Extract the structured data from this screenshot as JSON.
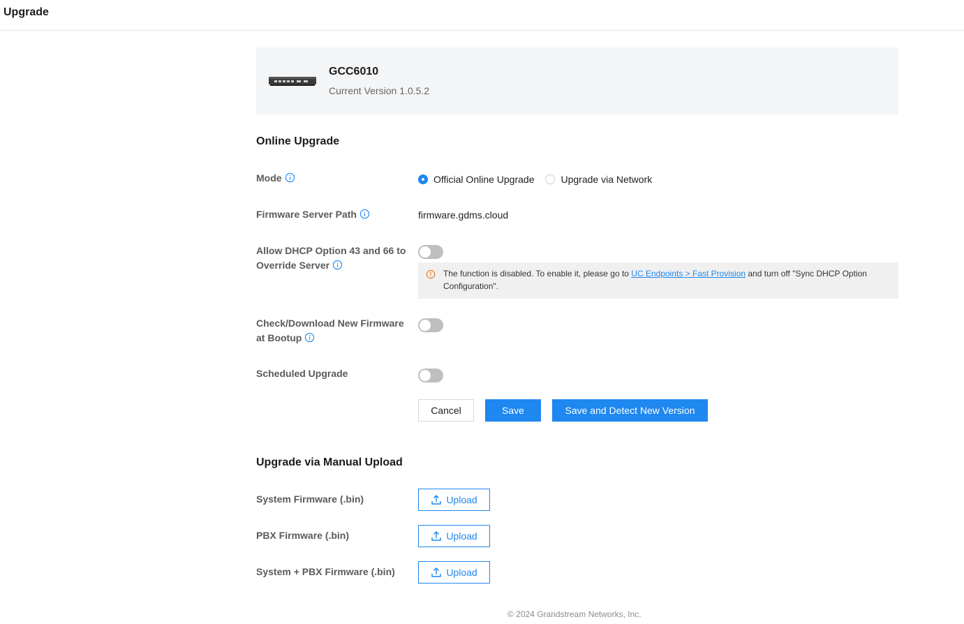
{
  "page": {
    "title": "Upgrade"
  },
  "device": {
    "image_icon": "network-device-icon",
    "name": "GCC6010",
    "version_label": "Current Version",
    "version": "1.0.5.2"
  },
  "online_upgrade": {
    "title": "Online Upgrade",
    "mode": {
      "label": "Mode",
      "options": [
        {
          "label": "Official Online Upgrade",
          "selected": true
        },
        {
          "label": "Upgrade via Network",
          "selected": false
        }
      ]
    },
    "firmware_server_path": {
      "label": "Firmware Server Path",
      "value": "firmware.gdms.cloud"
    },
    "dhcp_override": {
      "label": "Allow DHCP Option 43 and 66 to Override Server",
      "enabled": false,
      "notice_prefix": "The function is disabled. To enable it, please go to ",
      "notice_link": "UC Endpoints > Fast Provision",
      "notice_suffix": " and turn off \"Sync DHCP Option Configuration\"."
    },
    "check_at_bootup": {
      "label": "Check/Download New Firmware at Bootup",
      "enabled": false
    },
    "scheduled_upgrade": {
      "label": "Scheduled Upgrade",
      "enabled": false
    },
    "buttons": {
      "cancel": "Cancel",
      "save": "Save",
      "save_detect": "Save and Detect New Version"
    }
  },
  "manual_upload": {
    "title": "Upgrade via Manual Upload",
    "items": [
      {
        "label": "System Firmware (.bin)",
        "button": "Upload"
      },
      {
        "label": "PBX Firmware (.bin)",
        "button": "Upload"
      },
      {
        "label": "System + PBX Firmware (.bin)",
        "button": "Upload"
      }
    ]
  },
  "footer": {
    "copyright": "© 2024 Grandstream Networks, Inc."
  },
  "colors": {
    "accent": "#1e87f0",
    "warning": "#f07b1e",
    "toggle_off": "#bfbfbf"
  }
}
